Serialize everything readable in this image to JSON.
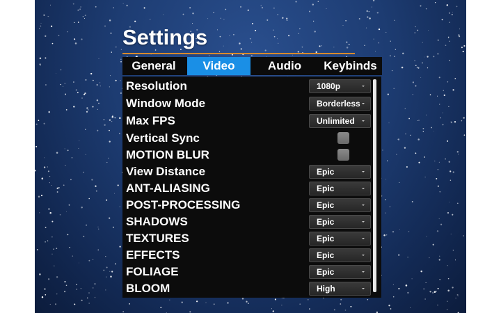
{
  "screen": {
    "title": "Settings"
  },
  "tabs": [
    {
      "label": "General",
      "active": false
    },
    {
      "label": "Video",
      "active": true
    },
    {
      "label": "Audio",
      "active": false
    },
    {
      "label": "Keybinds",
      "active": false
    }
  ],
  "settings": [
    {
      "label": "Resolution",
      "control": "dropdown",
      "value": "1080p"
    },
    {
      "label": "Window Mode",
      "control": "dropdown",
      "value": "Borderless"
    },
    {
      "label": "Max FPS",
      "control": "dropdown",
      "value": "Unlimited"
    },
    {
      "label": "Vertical Sync",
      "control": "checkbox",
      "checked": false
    },
    {
      "label": "MOTION BLUR",
      "control": "checkbox",
      "checked": false
    },
    {
      "label": "View Distance",
      "control": "dropdown",
      "value": "Epic"
    },
    {
      "label": "ANT-ALIASING",
      "control": "dropdown",
      "value": "Epic"
    },
    {
      "label": "POST-PROCESSING",
      "control": "dropdown",
      "value": "Epic"
    },
    {
      "label": "SHADOWS",
      "control": "dropdown",
      "value": "Epic"
    },
    {
      "label": "TEXTURES",
      "control": "dropdown",
      "value": "Epic"
    },
    {
      "label": "EFFECTS",
      "control": "dropdown",
      "value": "Epic"
    },
    {
      "label": "FOLIAGE",
      "control": "dropdown",
      "value": "Epic"
    },
    {
      "label": "BLOOM",
      "control": "dropdown",
      "value": "High"
    }
  ],
  "colors": {
    "accent": "#1a8fe6",
    "title_rule": "#d98a2b",
    "panel_bg": "#0c0c0c",
    "background_top": "#2a4f8e",
    "background_bottom": "#0c1c3c"
  },
  "icons": {
    "dropdown_caret": "chevron-down-icon"
  }
}
